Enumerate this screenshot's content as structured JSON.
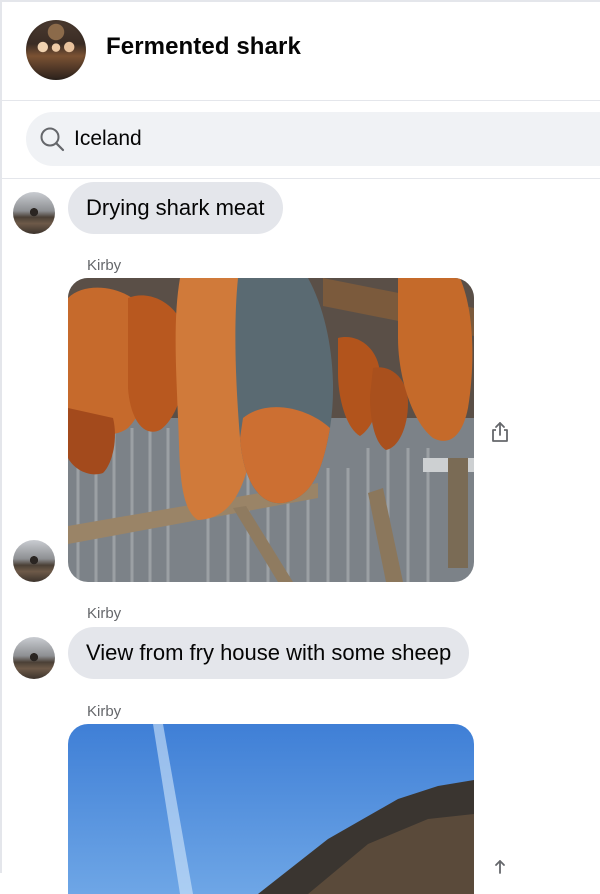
{
  "header": {
    "title": "Fermented shark"
  },
  "search": {
    "value": "Iceland",
    "icon": "search-icon"
  },
  "messages": [
    {
      "type": "text",
      "text": "Drying shark meat"
    },
    {
      "type": "photo",
      "sender": "Kirby",
      "subject": "dried shark meat hanging in drying shed"
    },
    {
      "type": "text",
      "sender": "Kirby",
      "text": "View from fry house with some sheep"
    },
    {
      "type": "photo",
      "sender": "Kirby",
      "subject": "blue sky over mountain"
    }
  ],
  "colors": {
    "bubble": "#e4e6eb",
    "sender_text": "#65676b",
    "search_bg": "#f0f2f5",
    "divider": "#e4e6eb"
  }
}
